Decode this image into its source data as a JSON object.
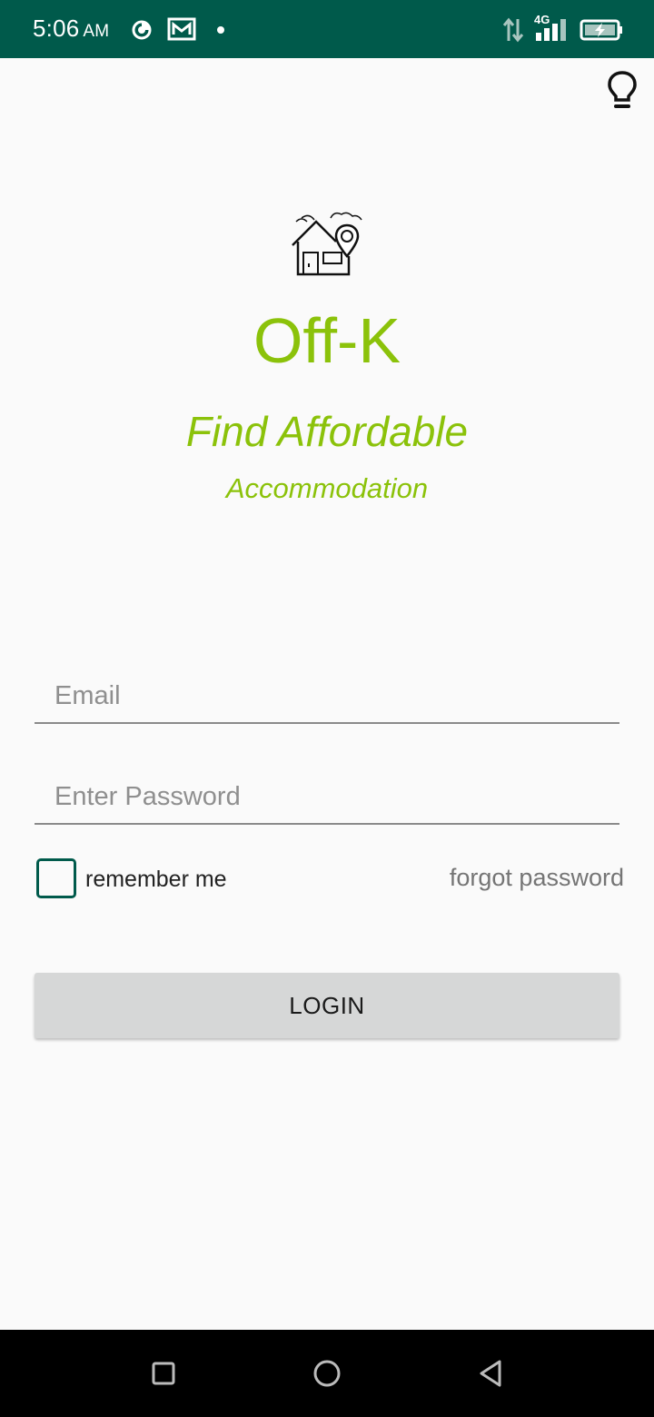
{
  "status_bar": {
    "time": "5:06",
    "ampm": "AM",
    "network": "4G",
    "icons": [
      "data-saver-icon",
      "gallery-notification-icon",
      "notification-dot-icon",
      "data-transfer-icon",
      "signal-icon",
      "battery-charging-icon"
    ],
    "background": "#005a4b"
  },
  "app": {
    "title": "Off-K",
    "tagline_line1": "Find Affordable",
    "tagline_line2": "Accommodation",
    "accent_color": "#8bc20a",
    "logo_icon": "house-location-icon",
    "theme_icon": "lightbulb-icon"
  },
  "form": {
    "email_placeholder": "Email",
    "email_value": "",
    "password_placeholder": "Enter Password",
    "password_value": "",
    "remember_label": "remember me",
    "remember_checked": false,
    "forgot_label": "forgot password",
    "login_label": "LOGIN"
  },
  "nav_bar": {
    "buttons": [
      "recents-square-icon",
      "home-circle-icon",
      "back-triangle-icon"
    ]
  }
}
